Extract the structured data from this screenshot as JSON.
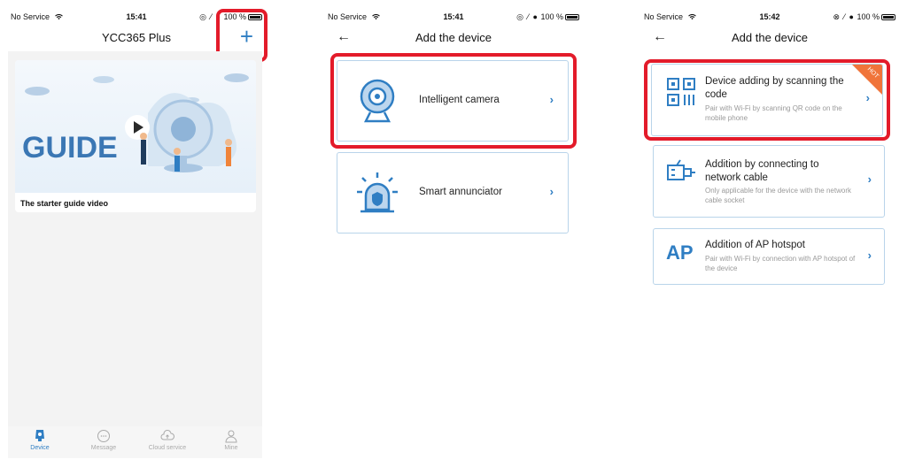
{
  "colors": {
    "accent": "#2f7ec3",
    "highlight": "#e31b2a",
    "hot": "#f0743a"
  },
  "screen1": {
    "status": {
      "carrier": "No Service",
      "time": "15:41",
      "battery": "100 %"
    },
    "title": "YCC365 Plus",
    "add_icon": "plus-icon",
    "guide_banner_text": "GUIDE",
    "guide_caption": "The starter guide video",
    "tabs": [
      {
        "label": "Device",
        "icon": "device-icon",
        "active": true
      },
      {
        "label": "Message",
        "icon": "message-icon",
        "active": false
      },
      {
        "label": "Cloud service",
        "icon": "cloud-icon",
        "active": false
      },
      {
        "label": "Mine",
        "icon": "user-icon",
        "active": false
      }
    ]
  },
  "screen2": {
    "status": {
      "carrier": "No Service",
      "time": "15:41",
      "battery": "100 %"
    },
    "title": "Add the device",
    "options": [
      {
        "label": "Intelligent camera",
        "icon": "camera-icon"
      },
      {
        "label": "Smart annunciator",
        "icon": "alarm-icon"
      }
    ]
  },
  "screen3": {
    "status": {
      "carrier": "No Service",
      "time": "15:42",
      "battery": "100 %"
    },
    "title": "Add the device",
    "options": [
      {
        "label": "Device adding by scanning the code",
        "sub": "Pair with Wi-Fi by scanning QR code on the mobile phone",
        "icon": "qr-code-icon",
        "badge": "HOT"
      },
      {
        "label": "Addition by connecting to network cable",
        "sub": "Only applicable for the device with the network cable socket",
        "icon": "ethernet-icon"
      },
      {
        "label": "Addition of AP hotspot",
        "sub": "Pair with Wi-Fi by connection with AP hotspot of the device",
        "icon": "ap-icon",
        "icon_text": "AP"
      }
    ]
  }
}
